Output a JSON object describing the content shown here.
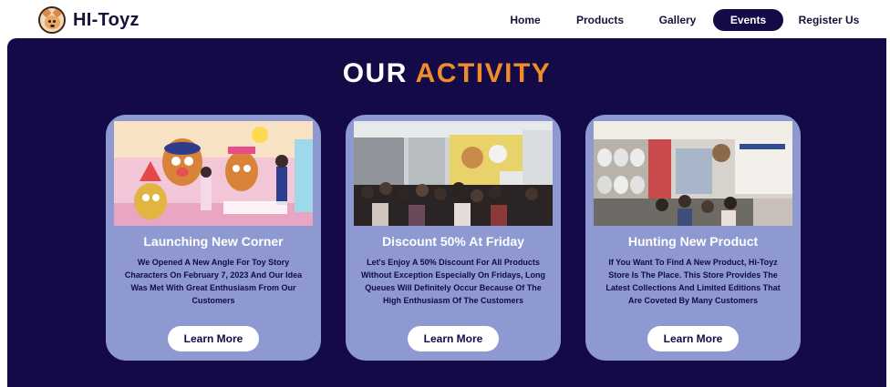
{
  "brand": {
    "name": "HI-Toyz"
  },
  "nav": {
    "items": [
      "Home",
      "Products",
      "Gallery",
      "Events",
      "Register Us"
    ],
    "active": "Events"
  },
  "section": {
    "title_part1": "OUR",
    "title_part2": "ACTIVITY"
  },
  "cards": [
    {
      "title": "Launching New Corner",
      "text": "We Opened A New Angle For Toy Story Characters On February 7, 2023 And Our Idea Was Met With Great Enthusiasm From Our Customers",
      "button": "Learn More"
    },
    {
      "title": "Discount 50% At Friday",
      "text": "Let's Enjoy A 50% Discount For All Products Without Exception Especially On Fridays, Long Queues Will Definitely Occur Because Of The High Enthusiasm Of The Customers",
      "button": "Learn More"
    },
    {
      "title": "Hunting New Product",
      "text": "If You Want To Find A New Product, Hi-Toyz Store Is The Place. This Store Provides The Latest Collections And Limited Editions That Are Coveted By Many Customers",
      "button": "Learn More"
    }
  ],
  "colors": {
    "navy": "#140a47",
    "card": "#8e99d1",
    "orange": "#f08c2b"
  }
}
